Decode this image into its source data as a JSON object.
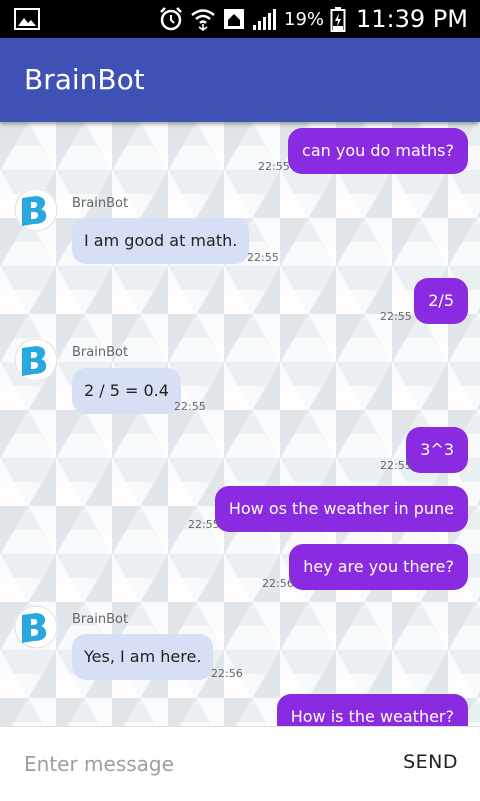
{
  "status_bar": {
    "battery_percent": "19%",
    "time": "11:39 PM",
    "icons": [
      "image-icon",
      "alarm-icon",
      "wifi-icon",
      "home-icon",
      "signal-icon",
      "battery-icon"
    ]
  },
  "app_bar": {
    "title": "BrainBot"
  },
  "chat": {
    "bot_name": "BrainBot",
    "messages": [
      {
        "from": "user",
        "text": "can you do maths?",
        "time": "22:55"
      },
      {
        "from": "bot",
        "text": "I am good at math.",
        "time": "22:55"
      },
      {
        "from": "user",
        "text": "2/5",
        "time": "22:55"
      },
      {
        "from": "bot",
        "text": "2 / 5 = 0.4",
        "time": "22:55"
      },
      {
        "from": "user",
        "text": "3^3",
        "time": "22:55"
      },
      {
        "from": "user",
        "text": "How os the weather in pune",
        "time": "22:55"
      },
      {
        "from": "user",
        "text": "hey are you there?",
        "time": "22:56"
      },
      {
        "from": "bot",
        "text": "Yes, I am here.",
        "time": "22:56"
      },
      {
        "from": "user",
        "text": "How is the weather?",
        "time": ""
      }
    ]
  },
  "composer": {
    "placeholder": "Enter message",
    "send_label": "SEND"
  },
  "colors": {
    "app_bar": "#3f51b5",
    "user_bubble": "#8a2be2",
    "bot_bubble": "#d7dff4",
    "avatar_accent": "#29a8e0"
  }
}
